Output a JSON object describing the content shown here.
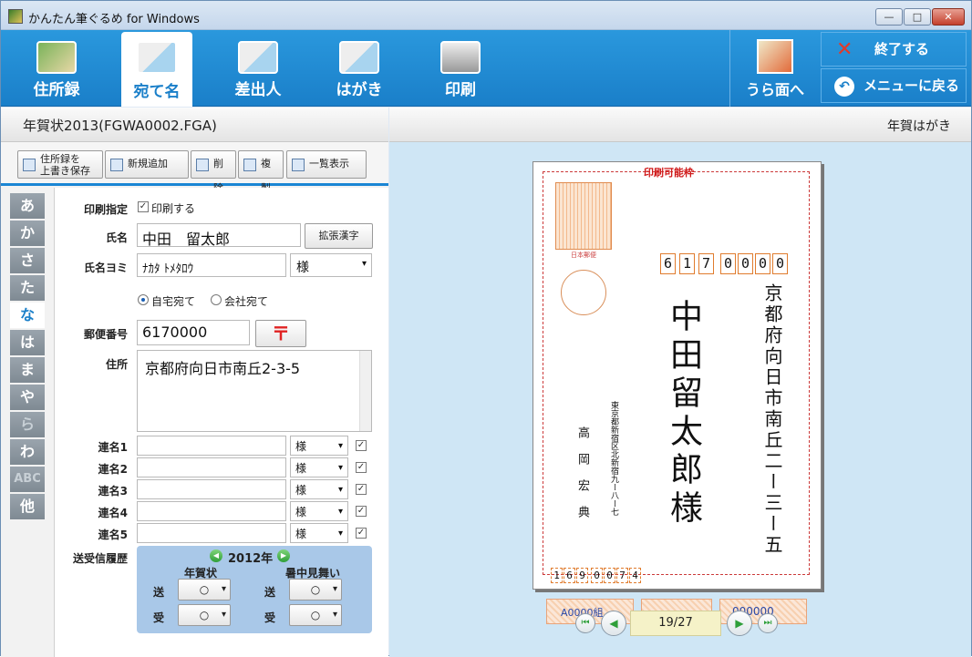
{
  "window": {
    "title": "かんたん筆ぐるめ for Windows"
  },
  "toolbar": {
    "address_book": "住所録",
    "recipient": "宛て名",
    "sender": "差出人",
    "postcard": "はがき",
    "print": "印刷",
    "back_side": "うら面へ",
    "exit": "終了する",
    "back_to_menu": "メニューに戻る"
  },
  "file": {
    "title": "年賀状2013(FGWA0002.FGA)"
  },
  "actions": {
    "save_line1": "住所録を",
    "save_line2": "上書き保存",
    "new": "新規追加",
    "delete": "削除",
    "copy": "複製",
    "list": "一覧表示"
  },
  "kana_tabs": [
    "あ",
    "か",
    "さ",
    "た",
    "な",
    "は",
    "ま",
    "や",
    "ら",
    "わ",
    "ABC",
    "他"
  ],
  "form": {
    "print_label": "印刷指定",
    "print_check": "印刷する",
    "name_label": "氏名",
    "name_value": "中田　留太郎",
    "kanji_button": "拡張漢字",
    "reading_label": "氏名ヨミ",
    "reading_value": "ﾅｶﾀ ﾄﾒﾀﾛｳ",
    "honorific": "様",
    "home_radio": "自宅宛て",
    "company_radio": "会社宛て",
    "postal_label": "郵便番号",
    "postal_value": "6170000",
    "postal_mark": "〒",
    "address_label": "住所",
    "address_value": "京都府向日市南丘2-3-5",
    "joint_labels": [
      "連名1",
      "連名2",
      "連名3",
      "連名4",
      "連名5"
    ],
    "joint_honorific": "様",
    "history_label": "送受信履歴",
    "history_year": "2012年",
    "history_col1": "年賀状",
    "history_col2": "暑中見舞い",
    "send_label": "送",
    "recv_label": "受",
    "history_mark": "○"
  },
  "preview": {
    "card_type": "年賀はがき",
    "print_frame": "印刷可能枠",
    "stamp_label": "日本郵便",
    "zip_digits": [
      "6",
      "1",
      "7",
      "0",
      "0",
      "0",
      "0"
    ],
    "address_vertical": "京都府向日市南丘二ー三ー五",
    "name_vertical": "中田留太郎様",
    "sender_address_vertical": "東京都新宿区北新宿九ー八ー七",
    "sender_name_vertical": "高岡宏典",
    "sender_zip": [
      "1",
      "6",
      "9",
      "0",
      "0",
      "7",
      "4"
    ],
    "lottery_group": "A0000組",
    "lottery_number": "000000",
    "page": "19/27"
  }
}
